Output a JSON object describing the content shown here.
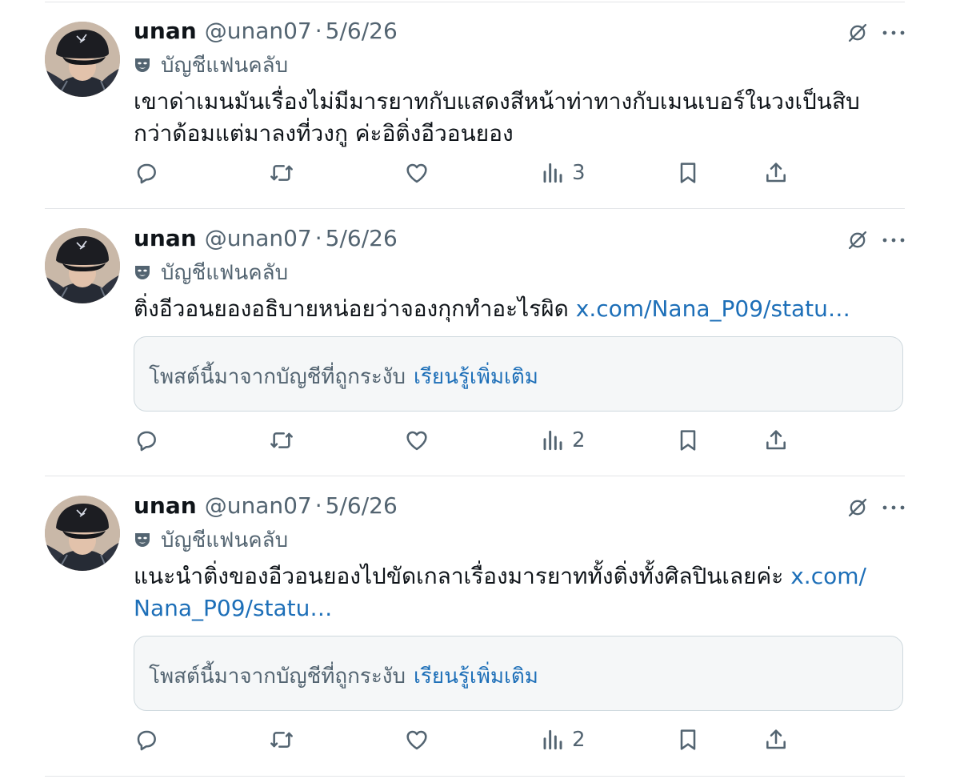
{
  "posts": [
    {
      "name": "unan",
      "handle": "@unan07",
      "separator": "·",
      "date": "5/6/26",
      "badge_label": "บัญชีแฟนคลับ",
      "text_lines": [
        "เขาด่าเมนมันเรื่องไม่มีมารยาทกับแสดงสีหน้าท่าทางกับเมนเบอร์ในวงเป็นสิบ",
        "กว่าด้อมแต่มาลงที่วงกู ค่ะอิติ่งอีวอนยอง"
      ],
      "link": "",
      "notice": null,
      "views": "3"
    },
    {
      "name": "unan",
      "handle": "@unan07",
      "separator": "·",
      "date": "5/6/26",
      "badge_label": "บัญชีแฟนคลับ",
      "text": "ติ่งอีวอนยองอธิบายหน่อยว่าจองกุกทำอะไรผิด",
      "link": "x.com/Nana_P09/statu…",
      "notice": {
        "text": "โพสต์นี้มาจากบัญชีที่ถูกระงับ",
        "link": "เรียนรู้เพิ่มเติม"
      },
      "views": "2"
    },
    {
      "name": "unan",
      "handle": "@unan07",
      "separator": "·",
      "date": "5/6/26",
      "badge_label": "บัญชีแฟนคลับ",
      "text": "แนะนำติ่งของอีวอนยองไปขัดเกลาเรื่องมารยาททั้งติ่งทั้งศิลปินเลยค่ะ",
      "link_line1": "x.com/",
      "link_line2": "Nana_P09/statu…",
      "notice": {
        "text": "โพสต์นี้มาจากบัญชีที่ถูกระงับ",
        "link": "เรียนรู้เพิ่มเติม"
      },
      "views": "2"
    }
  ],
  "icons": {
    "grok": "grok-icon",
    "more": "more-icon",
    "reply": "reply-icon",
    "repost": "repost-icon",
    "like": "like-icon",
    "views": "views-icon",
    "bookmark": "bookmark-icon",
    "share": "share-icon",
    "badge": "fan-account-mask-icon"
  },
  "colors": {
    "link": "#1d6fb8",
    "secondary": "#536471",
    "text": "#0f1419",
    "divider": "#e3e5e8"
  }
}
